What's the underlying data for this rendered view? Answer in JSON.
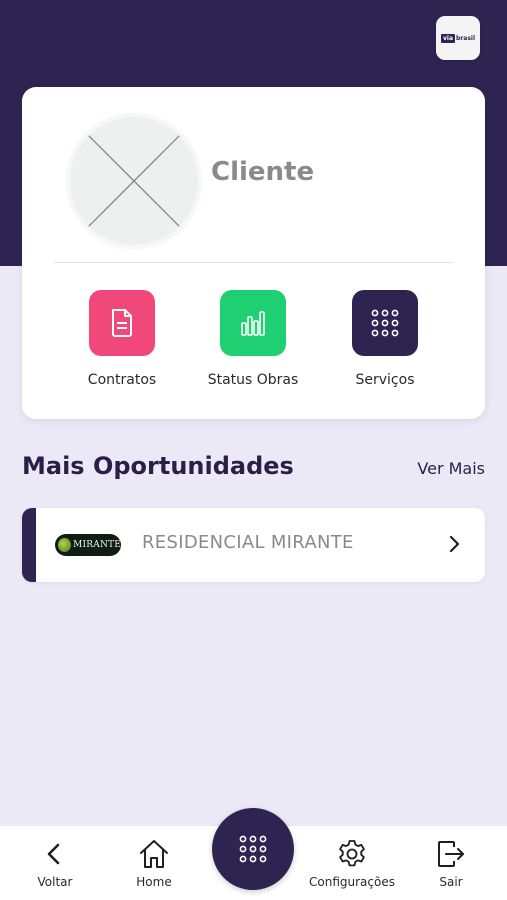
{
  "header": {
    "brand_logo": {
      "mark": "via",
      "word": "brasil"
    }
  },
  "profile": {
    "name": "Cliente"
  },
  "actions": [
    {
      "label": "Contratos",
      "icon": "document-icon",
      "color": "#f0487a"
    },
    {
      "label": "Status Obras",
      "icon": "bar-chart-icon",
      "color": "#1ed072"
    },
    {
      "label": "Serviços",
      "icon": "grid-dots-icon",
      "color": "#2e2452"
    }
  ],
  "opportunities": {
    "title": "Mais Oportunidades",
    "see_more": "Ver Mais",
    "items": [
      {
        "logo_text": "MIRANTE",
        "name": "RESIDENCIAL MIRANTE"
      }
    ]
  },
  "bottom_nav": {
    "items": [
      {
        "label": "Voltar",
        "icon": "chevron-left-icon"
      },
      {
        "label": "Home",
        "icon": "home-icon"
      },
      {
        "label": "Configurações",
        "icon": "gear-icon"
      },
      {
        "label": "Sair",
        "icon": "logout-icon"
      }
    ],
    "center_icon": "grid-dots-icon"
  },
  "colors": {
    "primary": "#2e2452",
    "background": "#eae9f5",
    "pink": "#f0487a",
    "green": "#1ed072"
  }
}
